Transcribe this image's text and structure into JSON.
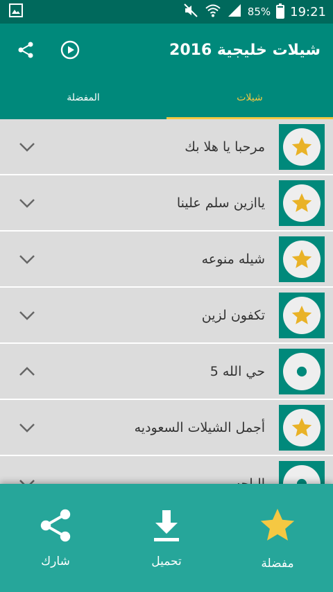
{
  "status_bar": {
    "battery": "85%",
    "time": "19:21",
    "icons": [
      "image-icon",
      "mute-icon",
      "wifi-icon",
      "signal-icon",
      "battery-icon"
    ]
  },
  "toolbar": {
    "title": "شيلات خليجية 2016",
    "icons": [
      "share-icon",
      "play-circle-icon"
    ]
  },
  "tabs": [
    {
      "label": "المفضلة",
      "active": false
    },
    {
      "label": "شيلات",
      "active": true
    }
  ],
  "list": {
    "items": [
      {
        "title": "مرحبا يا هلا بك",
        "icon": "star-icon",
        "expanded": false
      },
      {
        "title": "ياازين سلم علينا",
        "icon": "star-icon",
        "expanded": false
      },
      {
        "title": "شيله منوعه",
        "icon": "star-icon",
        "expanded": false
      },
      {
        "title": "تكفون لزين",
        "icon": "star-icon",
        "expanded": false
      },
      {
        "title": "حي الله 5",
        "icon": "dot-icon",
        "expanded": true
      },
      {
        "title": "أجمل الشيلات السعوديه",
        "icon": "star-icon",
        "expanded": false
      },
      {
        "title": "الباحه",
        "icon": "dot-icon",
        "expanded": false
      }
    ]
  },
  "bottom_bar": {
    "share_label": "شارك",
    "download_label": "تحميل",
    "favorite_label": "مفضلة"
  },
  "colors": {
    "primary_dark": "#00695c",
    "primary": "#00897b",
    "bottom_bar": "#26a69a",
    "accent": "#f5c842",
    "star": "#e9b227"
  }
}
